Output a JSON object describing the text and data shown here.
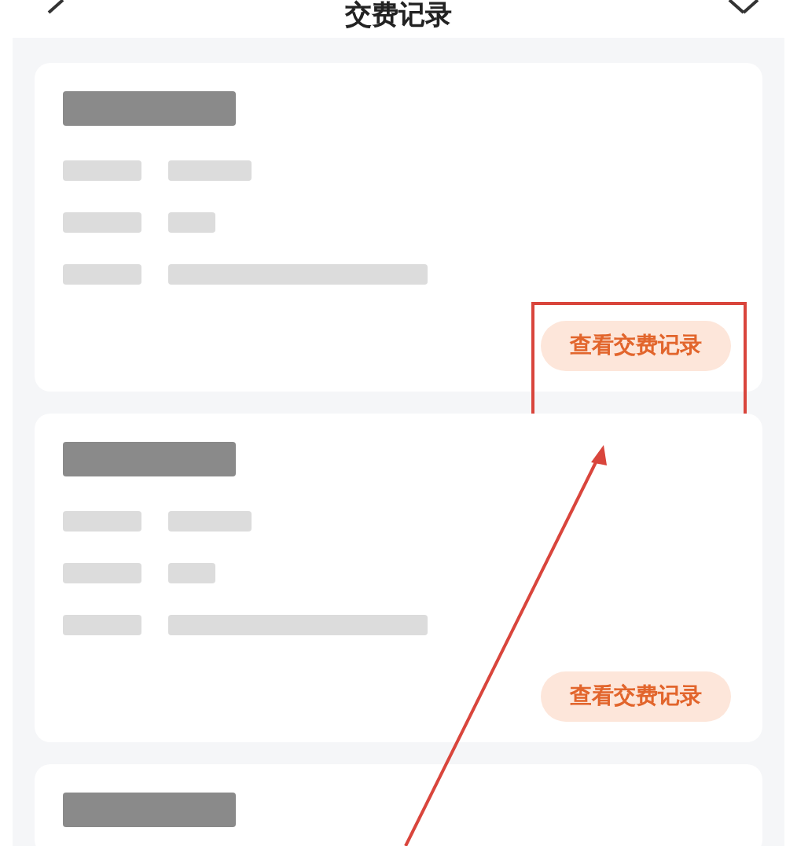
{
  "header": {
    "title": "交费记录"
  },
  "cards": [
    {
      "kind": "full",
      "button": "查看交费记录",
      "highlighted": true
    },
    {
      "kind": "full",
      "button": "查看交费记录",
      "highlighted": false
    },
    {
      "kind": "cut"
    }
  ]
}
